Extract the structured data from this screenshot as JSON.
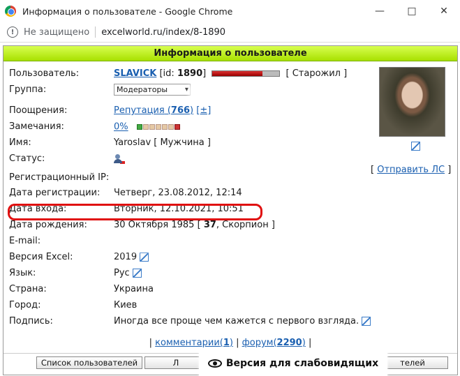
{
  "window": {
    "title": "Информация о пользователе - Google Chrome"
  },
  "address": {
    "security": "Не защищено",
    "url": "excelworld.ru/index/8-1890"
  },
  "panel": {
    "header": "Информация о пользователе"
  },
  "profile": {
    "user_label": "Пользователь:",
    "username": "SLAVICK",
    "id_prefix": "[id:",
    "id_value": "1890",
    "id_suffix": "]",
    "rank": "[ Старожил ]",
    "group_label": "Группа:",
    "group_value": "Модераторы",
    "rewards_label": "Поощрения:",
    "reputation_text": "Репутация",
    "reputation_open": " (",
    "reputation_value": "766",
    "reputation_close": ")",
    "reputation_pm": "[±]",
    "warnings_label": "Замечания:",
    "warnings_value": "0%",
    "name_label": "Имя:",
    "name_value": "Yaroslav [ Мужчина ]",
    "status_label": "Статус:",
    "send_pm": "Отправить ЛС",
    "reg_ip_label": "Регистрационный IP:",
    "reg_date_label": "Дата регистрации:",
    "reg_date_value": "Четверг, 23.08.2012, 12:14",
    "login_date_label": "Дата входа:",
    "login_date_value": "Вторник, 12.10.2021, 10:51",
    "birth_label": "Дата рождения:",
    "birth_date": "30 Октября 1985 [",
    "birth_age": "37",
    "birth_sign": ", Скорпион ]",
    "email_label": "E-mail:",
    "excel_label": "Версия Excel:",
    "excel_value": "2019",
    "lang_label": "Язык:",
    "lang_value": "Рус",
    "country_label": "Страна:",
    "country_value": "Украина",
    "city_label": "Город:",
    "city_value": "Киев",
    "signature_label": "Подпись:",
    "signature_value": "Иногда все проще чем кажется с первого взгляда."
  },
  "footer": {
    "comments": "комментарии",
    "comments_count": "1",
    "forum": "форум",
    "forum_count": "2290",
    "btn_users": "Список пользователей",
    "btn_2": "Л",
    "btn_3": "телей",
    "vision": "Версия для слабовидящих"
  },
  "icons": {
    "status": "user-status-icon",
    "edit": "edit-icon",
    "eye": "eye-icon"
  },
  "colors": {
    "header_green": "#b8f020",
    "link": "#1a5fb0",
    "highlight": "#e01010"
  }
}
